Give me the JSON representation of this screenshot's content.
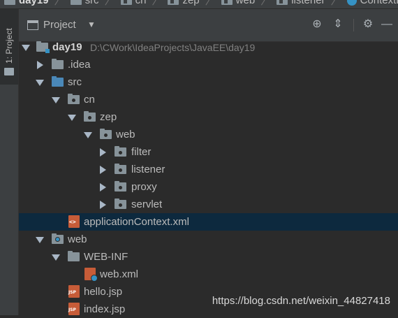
{
  "breadcrumbs": [
    {
      "label": "day19",
      "icon": "module-folder-icon"
    },
    {
      "label": "src",
      "icon": "folder-icon"
    },
    {
      "label": "cn",
      "icon": "package-icon"
    },
    {
      "label": "zep",
      "icon": "package-icon"
    },
    {
      "label": "web",
      "icon": "package-icon"
    },
    {
      "label": "listener",
      "icon": "package-icon"
    },
    {
      "label": "ContextLoader",
      "icon": "class-icon"
    }
  ],
  "stripe": {
    "tab_label": "1: Project"
  },
  "header": {
    "title": "Project",
    "caret": "▼",
    "locate": "⊕",
    "collapse": "⇕",
    "settings": "⚙",
    "hide": "—"
  },
  "tree": {
    "root": {
      "label": "day19",
      "path": "D:\\CWork\\IdeaProjects\\JavaEE\\day19"
    },
    "idea": {
      "label": ".idea"
    },
    "src": {
      "label": "src"
    },
    "cn": {
      "label": "cn"
    },
    "zep": {
      "label": "zep"
    },
    "web_pkg": {
      "label": "web"
    },
    "filter": {
      "label": "filter"
    },
    "listener": {
      "label": "listener"
    },
    "proxy": {
      "label": "proxy"
    },
    "servlet": {
      "label": "servlet"
    },
    "appctx": {
      "label": "applicationContext.xml"
    },
    "web": {
      "label": "web"
    },
    "webinf": {
      "label": "WEB-INF"
    },
    "webxml": {
      "label": "web.xml"
    },
    "hello": {
      "label": "hello.jsp"
    },
    "index": {
      "label": "index.jsp"
    }
  },
  "watermark": "https://blog.csdn.net/weixin_44827418",
  "colors": {
    "background": "#2b2b2b",
    "panel": "#3c3f41",
    "selection": "#0d293e",
    "text": "#bbbbbb"
  }
}
